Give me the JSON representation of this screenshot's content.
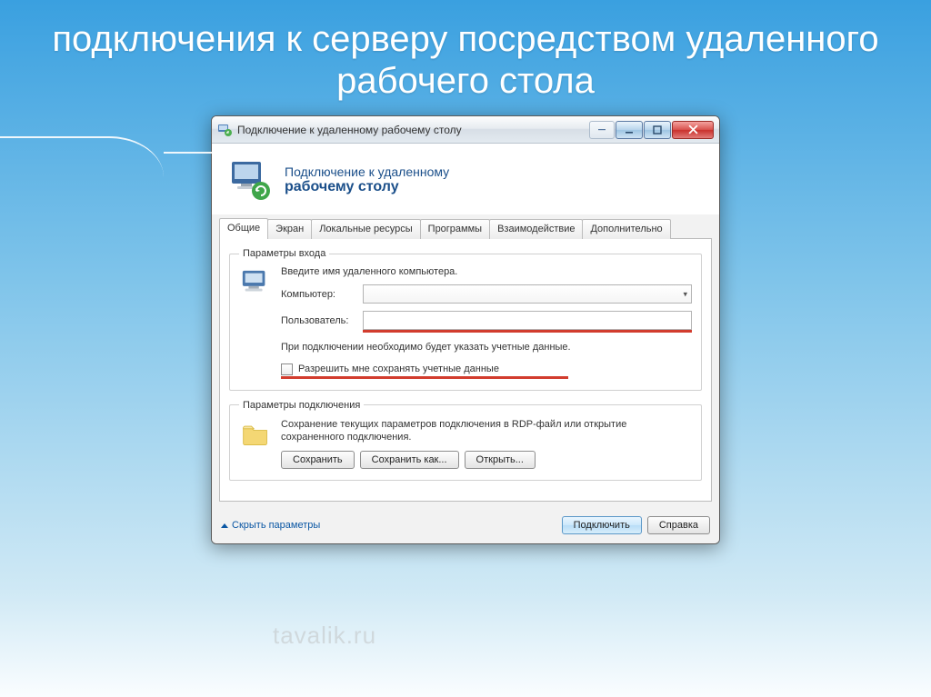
{
  "slide_title": "подключения к серверу посредством удаленного рабочего стола",
  "titlebar": {
    "text": "Подключение к удаленному рабочему столу"
  },
  "header": {
    "line1": "Подключение к удаленному",
    "line2": "рабочему столу"
  },
  "tabs": [
    {
      "label": "Общие",
      "active": true
    },
    {
      "label": "Экран"
    },
    {
      "label": "Локальные ресурсы"
    },
    {
      "label": "Программы"
    },
    {
      "label": "Взаимодействие"
    },
    {
      "label": "Дополнительно"
    }
  ],
  "login_group": {
    "legend": "Параметры входа",
    "instruction": "Введите имя удаленного компьютера.",
    "computer_label": "Компьютер:",
    "user_label": "Пользователь:",
    "note": "При подключении необходимо будет указать учетные данные.",
    "save_creds_label": "Разрешить мне сохранять учетные данные"
  },
  "conn_group": {
    "legend": "Параметры подключения",
    "note": "Сохранение текущих параметров подключения в RDP-файл или открытие сохраненного подключения.",
    "save": "Сохранить",
    "save_as": "Сохранить как...",
    "open": "Открыть..."
  },
  "footer": {
    "hide_link": "Скрыть параметры",
    "connect": "Подключить",
    "help": "Справка"
  },
  "watermark": "tavalik.ru"
}
